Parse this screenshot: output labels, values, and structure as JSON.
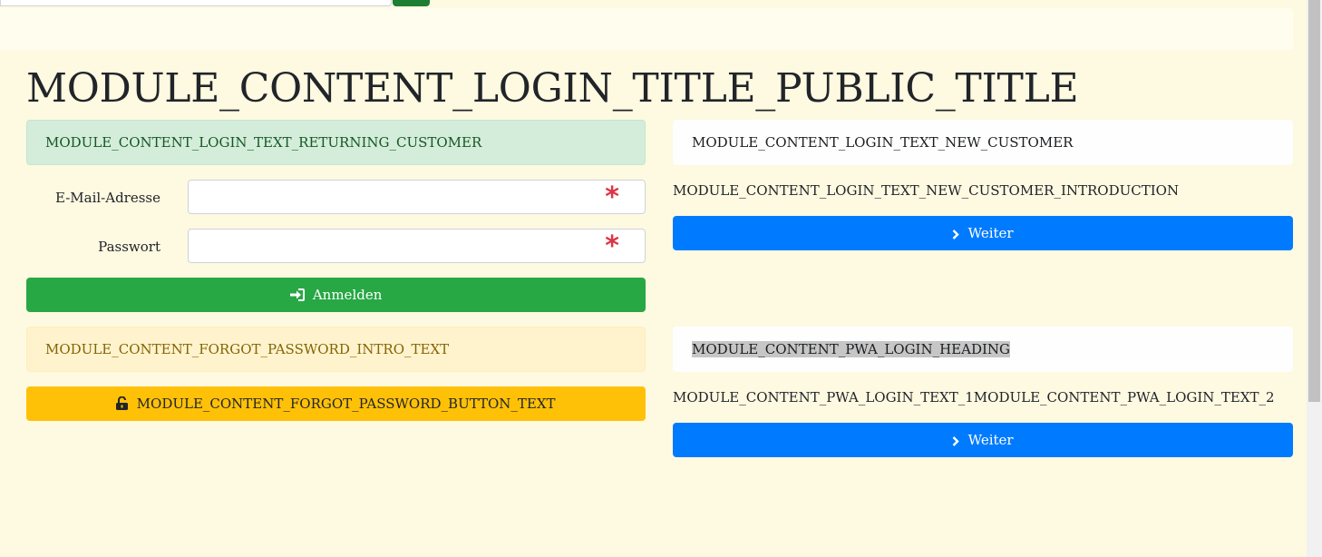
{
  "page": {
    "title": "MODULE_CONTENT_LOGIN_TITLE_PUBLIC_TITLE"
  },
  "returning_customer": {
    "alert_text": "MODULE_CONTENT_LOGIN_TEXT_RETURNING_CUSTOMER",
    "email_label": "E-Mail-Adresse",
    "email_value": "",
    "password_label": "Passwort",
    "password_value": "",
    "required_icon": "asterisk-icon",
    "login_button_label": "Anmelden",
    "login_icon": "sign-in-icon"
  },
  "forgot_password": {
    "intro_text": "MODULE_CONTENT_FORGOT_PASSWORD_INTRO_TEXT",
    "button_label": "MODULE_CONTENT_FORGOT_PASSWORD_BUTTON_TEXT",
    "button_icon": "unlock-icon"
  },
  "new_customer": {
    "heading": "MODULE_CONTENT_LOGIN_TEXT_NEW_CUSTOMER",
    "introduction": "MODULE_CONTENT_LOGIN_TEXT_NEW_CUSTOMER_INTRODUCTION",
    "continue_label": "Weiter",
    "continue_icon": "chevron-right-icon"
  },
  "pwa_login": {
    "heading": "MODULE_CONTENT_PWA_LOGIN_HEADING",
    "text": "MODULE_CONTENT_PWA_LOGIN_TEXT_1MODULE_CONTENT_PWA_LOGIN_TEXT_2",
    "continue_label": "Weiter",
    "continue_icon": "chevron-right-icon"
  },
  "colors": {
    "page_background": "#fef9e1",
    "success": "#28a745",
    "warning": "#ffc107",
    "primary": "#007bff",
    "danger": "#dc3545"
  }
}
